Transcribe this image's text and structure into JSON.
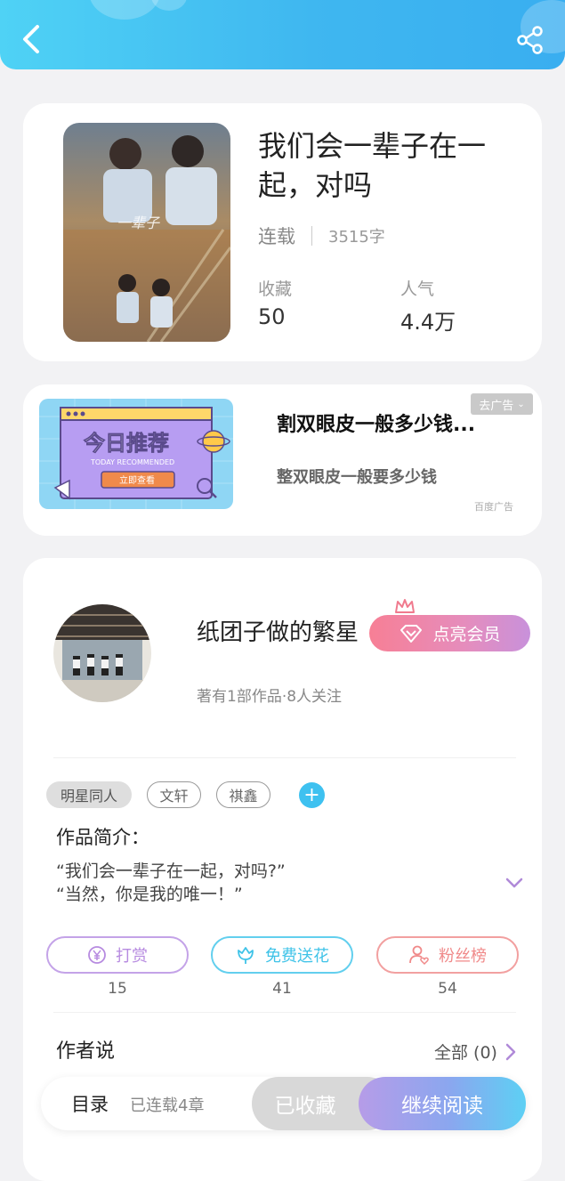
{
  "header": {
    "back_icon": "chevron-left-icon",
    "share_icon": "share-icon",
    "colors": {
      "start": "#4fd2f5",
      "end": "#39aef0"
    }
  },
  "book": {
    "title": "我们会一辈子在一起，对吗",
    "status": "连载",
    "word_count": "3515字",
    "favorites_label": "收藏",
    "favorites_value": "50",
    "popularity_label": "人气",
    "popularity_value": "4.4万"
  },
  "ad": {
    "title": "割双眼皮一般多少钱...",
    "subtitle": "整双眼皮一般要多少钱",
    "close_label": "去广告",
    "source": "百度广告",
    "image_text_main": "今日推荐",
    "image_text_en": "TODAY RECOMMENDED",
    "image_button": "立即查看"
  },
  "author": {
    "name": "纸团子做的繁星",
    "vip_label": "点亮会员",
    "summary": "著有1部作品·8人关注"
  },
  "tags": [
    "明星同人",
    "文轩",
    "祺鑫"
  ],
  "intro": {
    "label": "作品简介：",
    "line1": "“我们会一辈子在一起，对吗?”",
    "line2": "“当然，你是我的唯一！”"
  },
  "actions": [
    {
      "label": "打赏",
      "count": "15",
      "icon": "yen-icon",
      "color": "#b78be0"
    },
    {
      "label": "免费送花",
      "count": "41",
      "icon": "flower-icon",
      "color": "#3fc3e8"
    },
    {
      "label": "粉丝榜",
      "count": "54",
      "icon": "fan-icon",
      "color": "#f08a8a"
    }
  ],
  "author_says": {
    "label": "作者说",
    "all_label": "全部 (0)"
  },
  "bottom": {
    "toc_label": "目录",
    "toc_sub": "已连载4章",
    "favorited_label": "已收藏",
    "continue_label": "继续阅读"
  }
}
